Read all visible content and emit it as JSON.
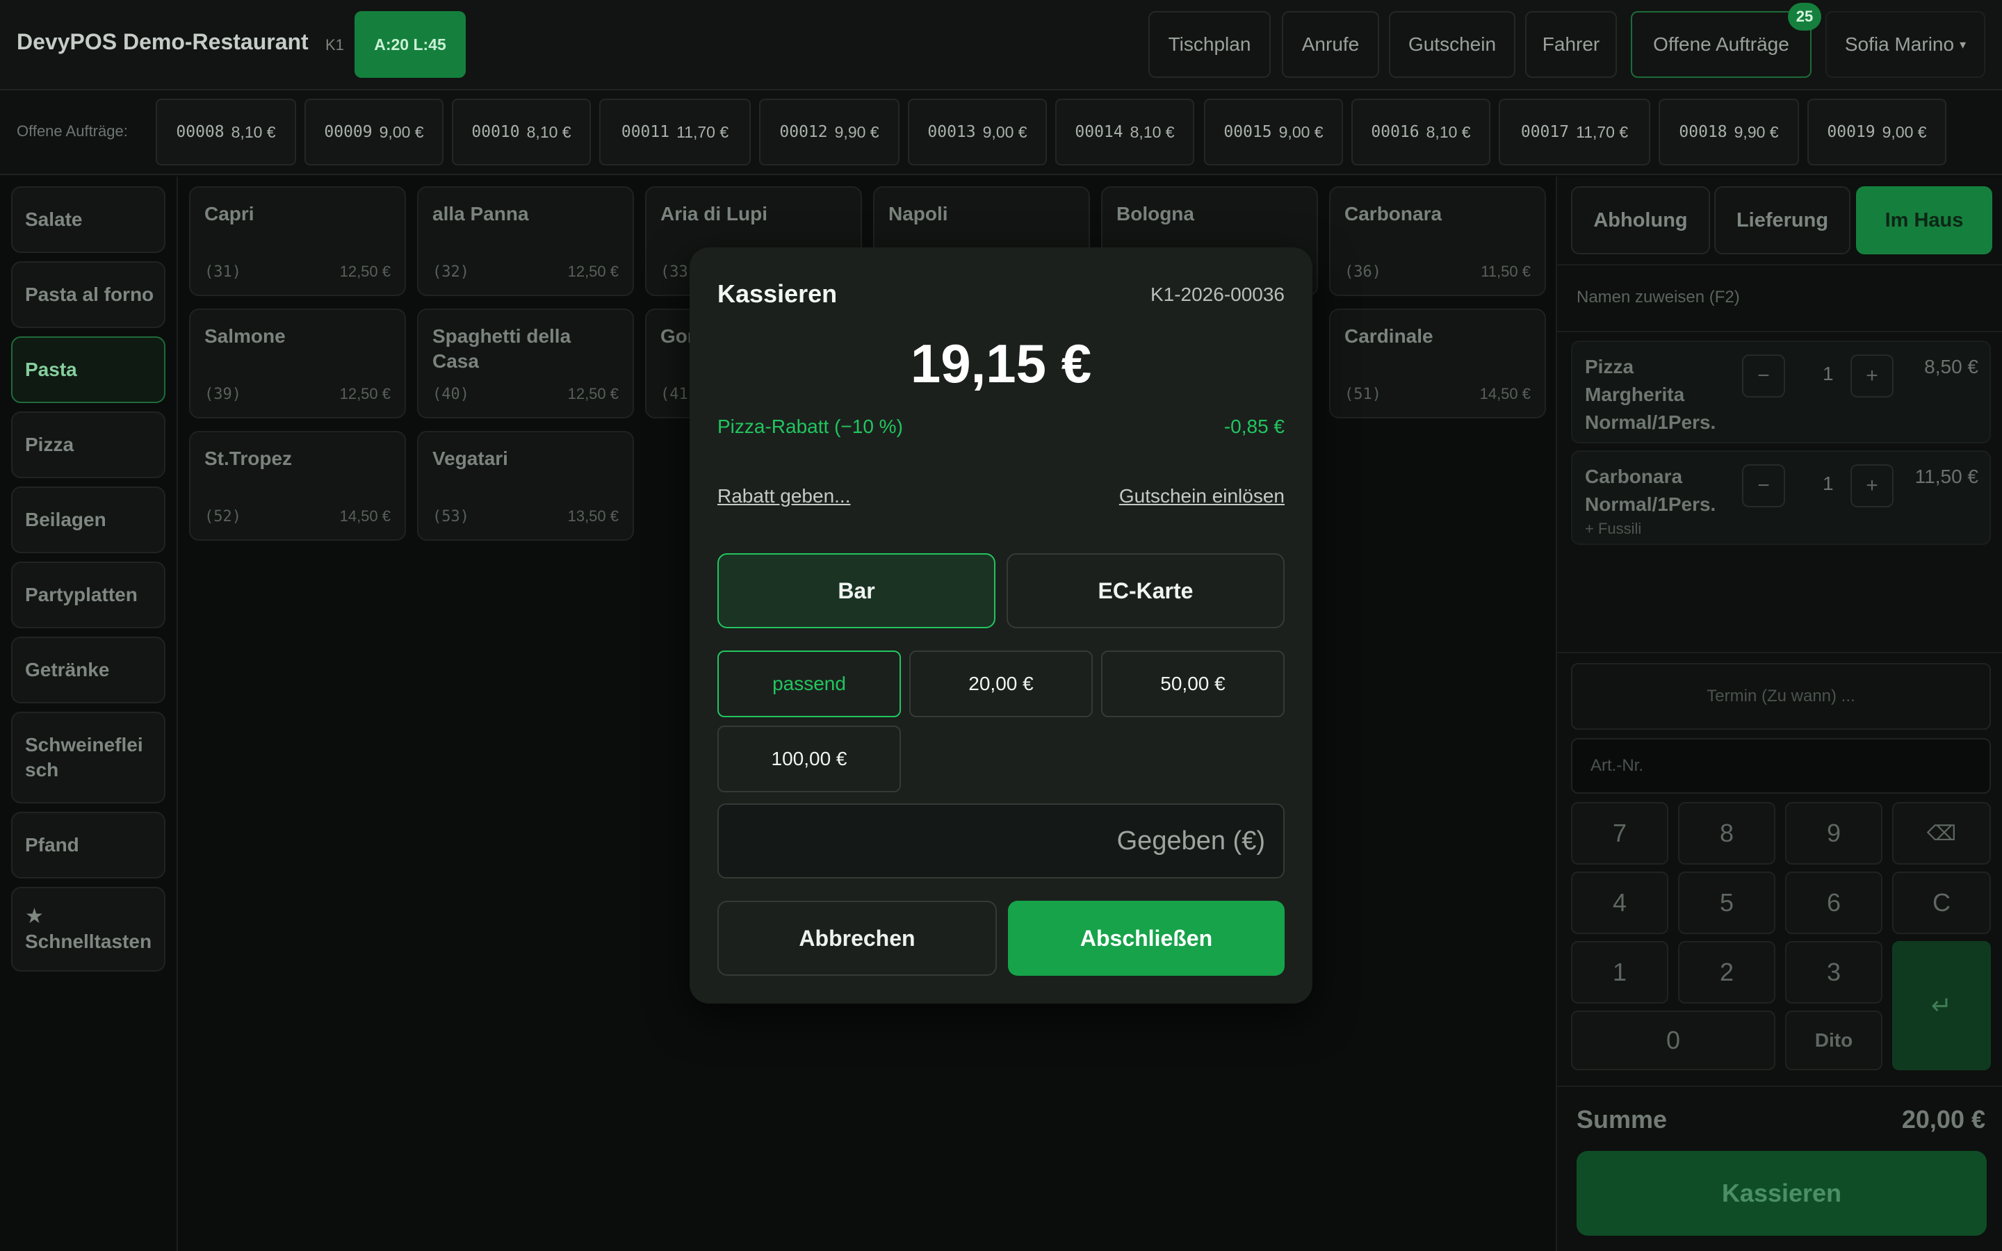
{
  "header": {
    "brand": "DevyPOS Demo-Restaurant",
    "terminal": "K1",
    "al_badge": "A:20 L:45",
    "nav": [
      "Tischplan",
      "Anrufe",
      "Gutschein",
      "Fahrer",
      "Offene Aufträge"
    ],
    "open_orders_count": "25",
    "user": "Sofia Marino",
    "user_caret": "▾"
  },
  "orders_strip": {
    "label": "Offene Aufträge:",
    "orders": [
      {
        "id": "00008",
        "amount": "8,10 €"
      },
      {
        "id": "00009",
        "amount": "9,00 €"
      },
      {
        "id": "00010",
        "amount": "8,10 €"
      },
      {
        "id": "00011",
        "amount": "11,70 €"
      },
      {
        "id": "00012",
        "amount": "9,90 €"
      },
      {
        "id": "00013",
        "amount": "9,00 €"
      },
      {
        "id": "00014",
        "amount": "8,10 €"
      },
      {
        "id": "00015",
        "amount": "9,00 €"
      },
      {
        "id": "00016",
        "amount": "8,10 €"
      },
      {
        "id": "00017",
        "amount": "11,70 €"
      },
      {
        "id": "00018",
        "amount": "9,90 €"
      },
      {
        "id": "00019",
        "amount": "9,00 €"
      }
    ]
  },
  "categories": [
    {
      "label": "Salate"
    },
    {
      "label": "Pasta al forno"
    },
    {
      "label": "Pasta",
      "active": true
    },
    {
      "label": "Pizza"
    },
    {
      "label": "Beilagen"
    },
    {
      "label": "Partyplatten"
    },
    {
      "label": "Getränke"
    },
    {
      "label": "Schweinefleisch",
      "line1": "Schweineflei",
      "line2": "sch"
    },
    {
      "label": "Pfand"
    },
    {
      "label": "Schnelltasten",
      "icon": "★"
    }
  ],
  "products": [
    {
      "name": "Capri",
      "num": "(31)",
      "price": "12,50 €"
    },
    {
      "name": "alla Panna",
      "num": "(32)",
      "price": "12,50 €"
    },
    {
      "name": "Aria di Lupi",
      "num": "(33",
      "price": ""
    },
    {
      "name": "Napoli",
      "num": "",
      "price": ""
    },
    {
      "name": "Bologna",
      "num": "",
      "price": ""
    },
    {
      "name": "Carbonara",
      "num": "(36)",
      "price": "11,50 €"
    },
    {
      "name": "Salmone",
      "num": "(39)",
      "price": "12,50 €"
    },
    {
      "name": "Spaghetti della Casa",
      "num": "(40)",
      "price": "12,50 €"
    },
    {
      "name": "Gor",
      "num": "(41",
      "price": ""
    },
    {
      "name": "Cardinale",
      "num": "(51)",
      "price": "14,50 €"
    },
    {
      "name": "St.Tropez",
      "num": "(52)",
      "price": "14,50 €"
    },
    {
      "name": "Vegatari",
      "num": "(53)",
      "price": "13,50 €"
    }
  ],
  "order_panel": {
    "tabs": [
      "Abholung",
      "Lieferung",
      "Im Haus"
    ],
    "name_placeholder": "Namen zuweisen (F2)",
    "items": [
      {
        "name_lines": [
          "Pizza",
          "Margherita",
          "Normal/1Pers."
        ],
        "qty": "1",
        "price": "8,50 €",
        "extra": ""
      },
      {
        "name_lines": [
          "Carbonara",
          "Normal/1Pers."
        ],
        "qty": "1",
        "price": "11,50 €",
        "extra": "+ Fussili"
      }
    ],
    "minus": "−",
    "plus": "+",
    "termin_placeholder": "Termin (Zu wann) ...",
    "artnr_placeholder": "Art.-Nr.",
    "keypad": [
      "7",
      "8",
      "9",
      "⌫",
      "4",
      "5",
      "6",
      "C",
      "1",
      "2",
      "3",
      "↵",
      "0",
      "Dito"
    ],
    "summe_label": "Summe",
    "summe_value": "20,00 €",
    "kassieren": "Kassieren"
  },
  "modal": {
    "title": "Kassieren",
    "order_id": "K1-2026-00036",
    "total": "19,15 €",
    "discount_label": "Pizza-Rabatt (−10 %)",
    "discount_value": "-0,85 €",
    "rabatt_link": "Rabatt geben...",
    "voucher_link": "Gutschein einlösen",
    "methods": [
      "Bar",
      "EC-Karte"
    ],
    "active_method": "Bar",
    "quick_amounts": [
      "passend",
      "20,00 €",
      "50,00 €",
      "100,00 €"
    ],
    "given_placeholder": "Gegeben (€)",
    "cancel": "Abbrechen",
    "finish": "Abschließen"
  },
  "colors": {
    "accent": "#16a34a",
    "accent_text": "#22c55e",
    "background": "#0b0d0c"
  }
}
